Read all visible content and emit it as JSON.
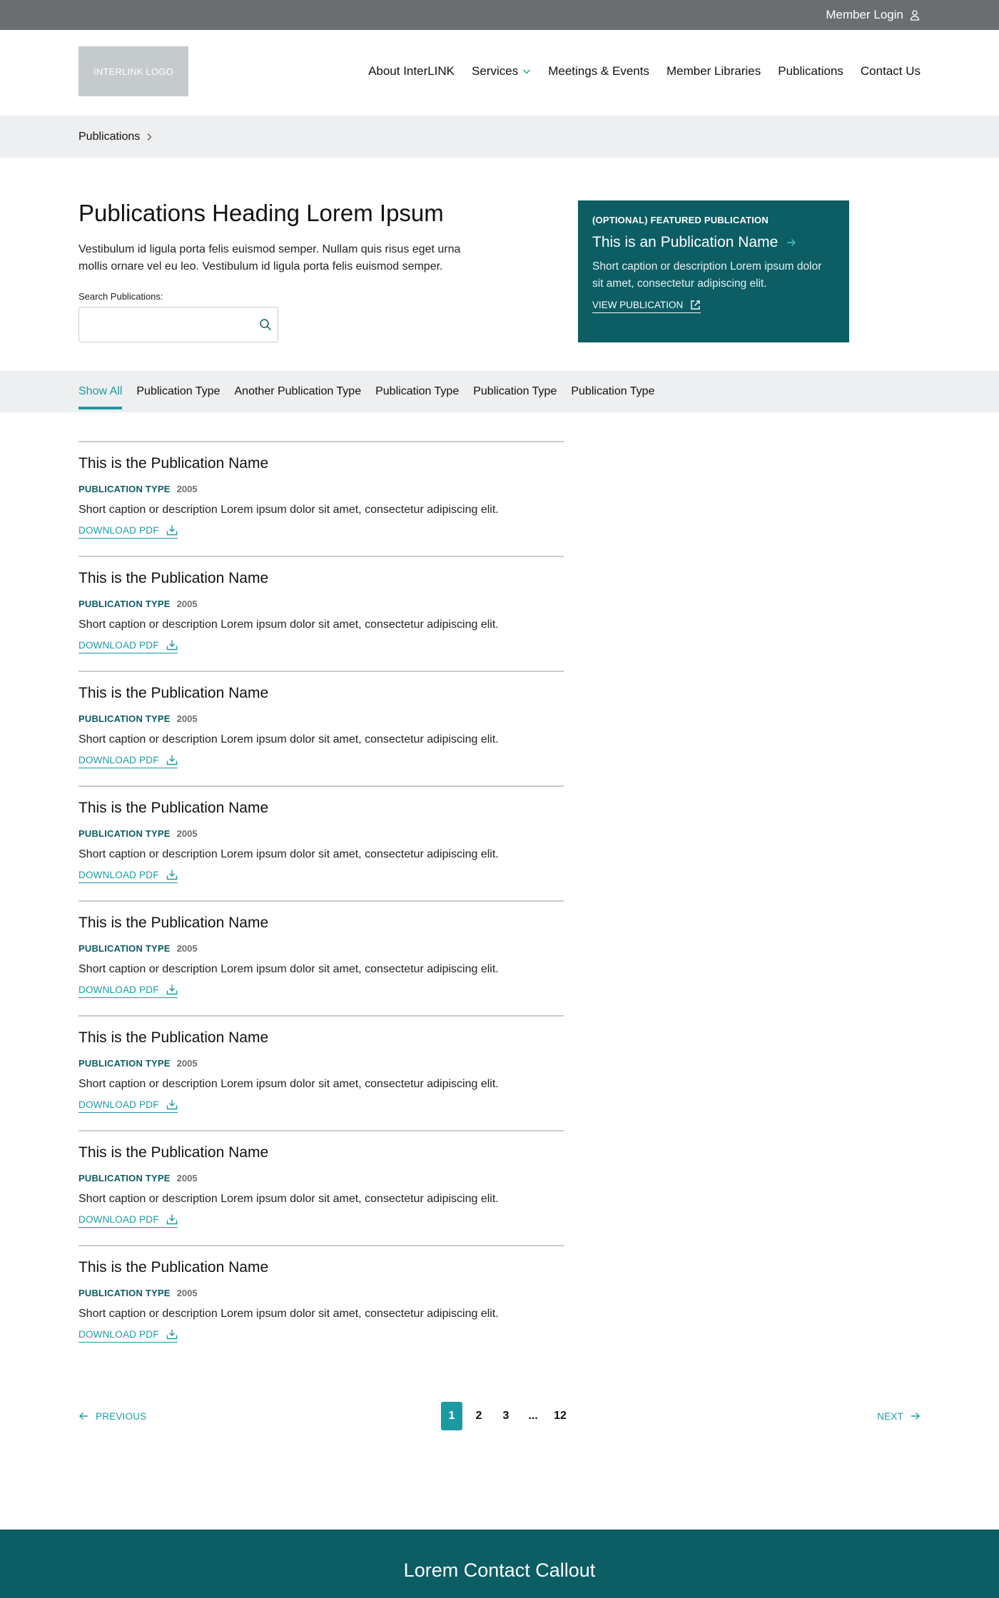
{
  "topbar": {
    "member_login": "Member Login"
  },
  "header": {
    "logo_text": "INTERLINK LOGO",
    "nav": [
      {
        "label": "About InterLINK"
      },
      {
        "label": "Services"
      },
      {
        "label": "Meetings & Events"
      },
      {
        "label": "Member Libraries"
      },
      {
        "label": "Publications"
      },
      {
        "label": "Contact Us"
      }
    ]
  },
  "breadcrumb": {
    "label": "Publications"
  },
  "hero": {
    "title": "Publications Heading Lorem Ipsum",
    "description": "Vestibulum id ligula porta felis euismod semper. Nullam quis risus eget urna mollis ornare vel eu leo. Vestibulum id ligula porta felis euismod semper.",
    "search_label": "Search Publications:",
    "search_placeholder": "",
    "search_value": ""
  },
  "featured": {
    "kicker": "(OPTIONAL) FEATURED PUBLICATION",
    "title": "This is an Publication Name",
    "description": "Short caption or description Lorem ipsum dolor sit amet, consectetur adipiscing elit.",
    "link_label": "VIEW PUBLICATION"
  },
  "filters": [
    {
      "label": "Show All",
      "active": true
    },
    {
      "label": "Publication Type",
      "active": false
    },
    {
      "label": "Another Publication Type",
      "active": false
    },
    {
      "label": "Publication Type",
      "active": false
    },
    {
      "label": "Publication Type",
      "active": false
    },
    {
      "label": "Publication Type",
      "active": false
    }
  ],
  "publications": [
    {
      "title": "This is the Publication Name",
      "type": "PUBLICATION TYPE",
      "year": "2005",
      "description": "Short caption or description Lorem ipsum dolor sit amet, consectetur adipiscing elit.",
      "download_label": "DOWNLOAD PDF"
    },
    {
      "title": "This is the Publication Name",
      "type": "PUBLICATION TYPE",
      "year": "2005",
      "description": "Short caption or description Lorem ipsum dolor sit amet, consectetur adipiscing elit.",
      "download_label": "DOWNLOAD PDF"
    },
    {
      "title": "This is the Publication Name",
      "type": "PUBLICATION TYPE",
      "year": "2005",
      "description": "Short caption or description Lorem ipsum dolor sit amet, consectetur adipiscing elit.",
      "download_label": "DOWNLOAD PDF"
    },
    {
      "title": "This is the Publication Name",
      "type": "PUBLICATION TYPE",
      "year": "2005",
      "description": "Short caption or description Lorem ipsum dolor sit amet, consectetur adipiscing elit.",
      "download_label": "DOWNLOAD PDF"
    },
    {
      "title": "This is the Publication Name",
      "type": "PUBLICATION TYPE",
      "year": "2005",
      "description": "Short caption or description Lorem ipsum dolor sit amet, consectetur adipiscing elit.",
      "download_label": "DOWNLOAD PDF"
    },
    {
      "title": "This is the Publication Name",
      "type": "PUBLICATION TYPE",
      "year": "2005",
      "description": "Short caption or description Lorem ipsum dolor sit amet, consectetur adipiscing elit.",
      "download_label": "DOWNLOAD PDF"
    },
    {
      "title": "This is the Publication Name",
      "type": "PUBLICATION TYPE",
      "year": "2005",
      "description": "Short caption or description Lorem ipsum dolor sit amet, consectetur adipiscing elit.",
      "download_label": "DOWNLOAD PDF"
    },
    {
      "title": "This is the Publication Name",
      "type": "PUBLICATION TYPE",
      "year": "2005",
      "description": "Short caption or description Lorem ipsum dolor sit amet, consectetur adipiscing elit.",
      "download_label": "DOWNLOAD PDF"
    }
  ],
  "pagination": {
    "previous_label": "PREVIOUS",
    "next_label": "NEXT",
    "pages": [
      "1",
      "2",
      "3",
      "...",
      "12"
    ],
    "current": "1"
  },
  "footer": {
    "callout_title": "Lorem Contact Callout"
  },
  "colors": {
    "teal_dark": "#0c5d64",
    "teal_accent": "#1c9aa3",
    "topbar_gray": "#6b6e70",
    "band_gray": "#eeeff0"
  },
  "icons": {
    "member_login": "user-icon",
    "services": "chevron-down-icon",
    "breadcrumb": "chevron-right-icon",
    "search": "search-icon",
    "featured_title": "arrow-right-icon",
    "featured_link": "external-link-icon",
    "download": "download-icon",
    "previous": "arrow-left-icon",
    "next": "arrow-right-icon"
  }
}
